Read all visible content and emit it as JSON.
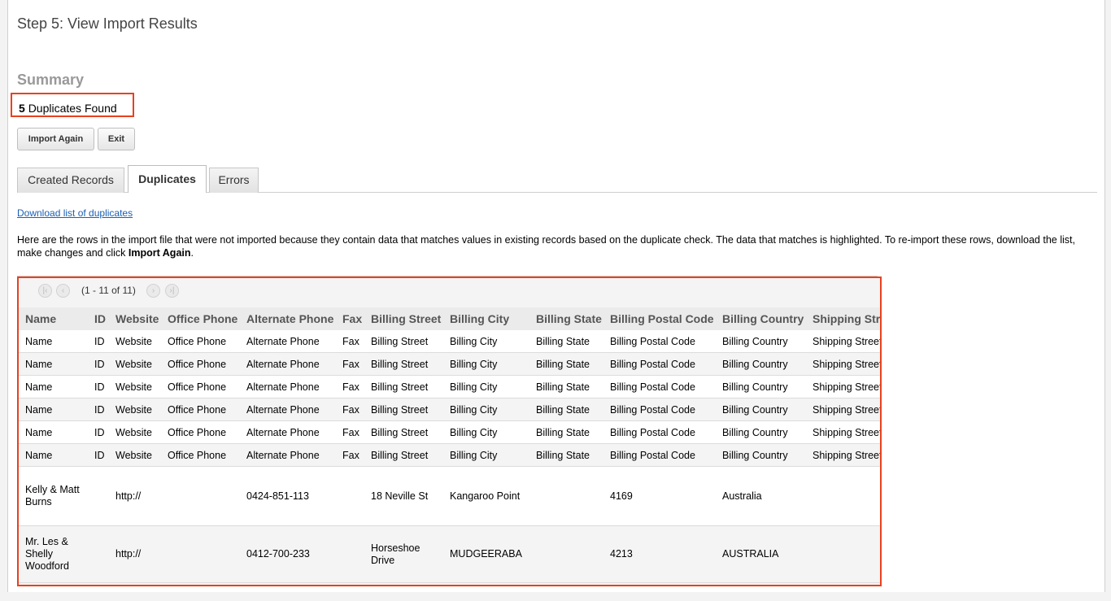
{
  "step_title": "Step 5: View Import Results",
  "summary": {
    "heading": "Summary",
    "duplicates_count": "5",
    "duplicates_label": "Duplicates Found",
    "highlight_color": "#e8411f"
  },
  "buttons": {
    "import_again": "Import Again",
    "exit": "Exit"
  },
  "tabs": [
    {
      "label": "Created Records",
      "active": false
    },
    {
      "label": "Duplicates",
      "active": true
    },
    {
      "label": "Errors",
      "active": false
    }
  ],
  "download_link": "Download list of duplicates",
  "description": {
    "text": "Here are the rows in the import file that were not imported because they contain data that matches values in existing records based on the duplicate check. The data that matches is highlighted. To re-import these rows, download the list, make changes and click ",
    "bold": "Import Again",
    "end": "."
  },
  "pager": {
    "first_icon": "first-page-icon",
    "prev_icon": "prev-page-icon",
    "next_icon": "next-page-icon",
    "last_icon": "last-page-icon",
    "info": "(1 - 11 of 11)"
  },
  "table": {
    "columns": [
      "Name",
      "ID",
      "Website",
      "Office Phone",
      "Alternate Phone",
      "Fax",
      "Billing Street",
      "Billing City",
      "Billing State",
      "Billing Postal Code",
      "Billing Country",
      "Shipping Street"
    ],
    "header_rows": [
      [
        "Name",
        "ID",
        "Website",
        "Office Phone",
        "Alternate Phone",
        "Fax",
        "Billing Street",
        "Billing City",
        "Billing State",
        "Billing Postal Code",
        "Billing Country",
        "Shipping Street"
      ],
      [
        "Name",
        "ID",
        "Website",
        "Office Phone",
        "Alternate Phone",
        "Fax",
        "Billing Street",
        "Billing City",
        "Billing State",
        "Billing Postal Code",
        "Billing Country",
        "Shipping Street"
      ],
      [
        "Name",
        "ID",
        "Website",
        "Office Phone",
        "Alternate Phone",
        "Fax",
        "Billing Street",
        "Billing City",
        "Billing State",
        "Billing Postal Code",
        "Billing Country",
        "Shipping Street"
      ],
      [
        "Name",
        "ID",
        "Website",
        "Office Phone",
        "Alternate Phone",
        "Fax",
        "Billing Street",
        "Billing City",
        "Billing State",
        "Billing Postal Code",
        "Billing Country",
        "Shipping Street"
      ],
      [
        "Name",
        "ID",
        "Website",
        "Office Phone",
        "Alternate Phone",
        "Fax",
        "Billing Street",
        "Billing City",
        "Billing State",
        "Billing Postal Code",
        "Billing Country",
        "Shipping Street"
      ],
      [
        "Name",
        "ID",
        "Website",
        "Office Phone",
        "Alternate Phone",
        "Fax",
        "Billing Street",
        "Billing City",
        "Billing State",
        "Billing Postal Code",
        "Billing Country",
        "Shipping Street"
      ]
    ],
    "data_rows": [
      [
        "Kelly & Matt Burns",
        "",
        "http://",
        "",
        "0424-851-113",
        "",
        "18 Neville St",
        "Kangaroo Point",
        "",
        "4169",
        "Australia",
        ""
      ],
      [
        "Mr. Les & Shelly Woodford",
        "",
        "http://",
        "",
        "0412-700-233",
        "",
        "Horseshoe Drive",
        "MUDGEERABA",
        "",
        "4213",
        "AUSTRALIA",
        ""
      ]
    ]
  }
}
